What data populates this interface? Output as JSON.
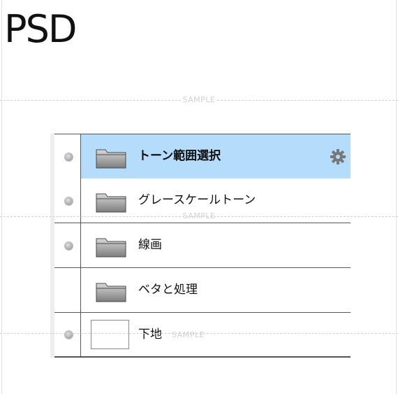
{
  "header": {
    "title": "PSD"
  },
  "watermark": {
    "text": "SAMPLE"
  },
  "layers_panel": {
    "layers": [
      {
        "name": "トーン範囲選択",
        "type": "folder",
        "visible": true,
        "selected": true,
        "settings_icon": "gear-icon"
      },
      {
        "name": "グレースケールトーン",
        "type": "folder",
        "visible": true,
        "selected": false
      },
      {
        "name": "線画",
        "type": "folder",
        "visible": true,
        "selected": false
      },
      {
        "name": "ベタと処理",
        "type": "folder",
        "visible": false,
        "selected": false
      },
      {
        "name": "下地",
        "type": "layer",
        "visible": true,
        "selected": false
      }
    ]
  },
  "colors": {
    "selected_row": "#b5dcfb",
    "border": "#555555",
    "watermark": "#d0d0d0"
  }
}
